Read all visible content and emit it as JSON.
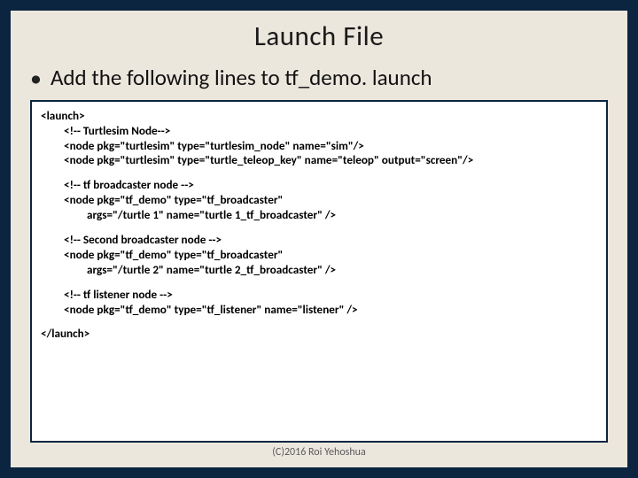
{
  "title": "Launch File",
  "bullet": "•",
  "bullet_text": "Add the following lines to tf_demo. launch",
  "code": {
    "b1": {
      "l1": "<launch>",
      "l2": "<!-- Turtlesim Node-->",
      "l3": "<node pkg=\"turtlesim\" type=\"turtlesim_node\" name=\"sim\"/>",
      "l4": "<node pkg=\"turtlesim\" type=\"turtle_teleop_key\" name=\"teleop\" output=\"screen\"/>"
    },
    "b2": {
      "l1": "<!-- tf broadcaster node -->",
      "l2": "<node pkg=\"tf_demo\" type=\"tf_broadcaster\"",
      "l3": "args=\"/turtle 1\" name=\"turtle 1_tf_broadcaster\" />"
    },
    "b3": {
      "l1": "<!-- Second broadcaster node -->",
      "l2": "<node pkg=\"tf_demo\" type=\"tf_broadcaster\"",
      "l3": "args=\"/turtle 2\" name=\"turtle 2_tf_broadcaster\" />"
    },
    "b4": {
      "l1": "<!-- tf listener node -->",
      "l2": "<node pkg=\"tf_demo\" type=\"tf_listener\" name=\"listener\" />"
    },
    "b5": {
      "l1": "</launch>"
    }
  },
  "footer": "(C)2016 Roi Yehoshua"
}
